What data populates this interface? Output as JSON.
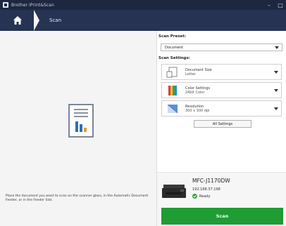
{
  "window": {
    "title": "Brother iPrint&Scan",
    "minimize_glyph": "–",
    "close_glyph": "□"
  },
  "nav": {
    "home_icon": "home-icon",
    "scan_tab_label": "Scan"
  },
  "left": {
    "message": "Place the document you want to scan on the scanner glass, in the Automatic Document Feeder, or in the Feeder Slot."
  },
  "right": {
    "preset_label": "Scan Preset:",
    "preset_value": "Document",
    "settings_label": "Scan Settings:",
    "settings": [
      {
        "icon": "document-size-icon",
        "title": "Document Size",
        "value": "Letter"
      },
      {
        "icon": "color-settings-icon",
        "title": "Color Settings",
        "value": "24bit Color"
      },
      {
        "icon": "resolution-icon",
        "title": "Resolution",
        "value": "300 x 300 dpi"
      }
    ],
    "all_settings_label": "All Settings"
  },
  "device": {
    "name": "MFC-J1170DW",
    "ip": "192.168.37.198",
    "status": "Ready"
  },
  "actions": {
    "scan_label": "Scan"
  },
  "colors": {
    "titlebar": "#1d2740",
    "navbar": "#263352",
    "scan_button": "#1f9c34",
    "status_ok": "#2f9e3a"
  }
}
